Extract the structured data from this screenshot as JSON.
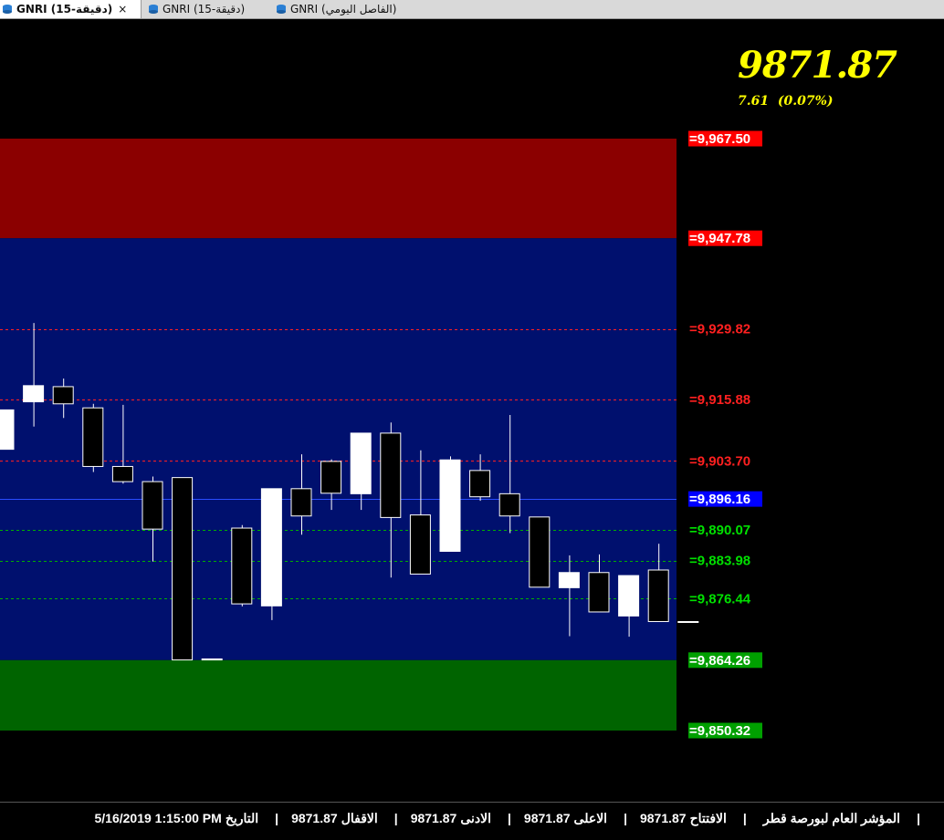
{
  "tabs": [
    {
      "label": "GNRI (15-دقيقة)",
      "active": true,
      "icon": "chart-db-icon"
    },
    {
      "label": "GNRI (15-دقيقة)",
      "active": false,
      "icon": "chart-db-icon"
    },
    {
      "label": "GNRI (الفاصل اليومي)",
      "active": false,
      "icon": "chart-db-icon"
    }
  ],
  "close_glyph": "×",
  "quote": {
    "last": "9871.87",
    "change": "7.61  (0.07%)",
    "color": "#ffff00"
  },
  "zones": [
    {
      "name": "resistance-zone",
      "from": 9947.78,
      "to": 9967.5,
      "color": "#8b0000"
    },
    {
      "name": "neutral-zone",
      "from": 9864.26,
      "to": 9947.78,
      "color": "#00106e"
    },
    {
      "name": "support-zone",
      "from": 9850.32,
      "to": 9864.26,
      "color": "#006400"
    }
  ],
  "levels": [
    {
      "label": "=9,967.50",
      "value": 9967.5,
      "style": "box",
      "bg": "#ff0000",
      "fg": "#ffffff"
    },
    {
      "label": "=9,947.78",
      "value": 9947.78,
      "style": "box",
      "bg": "#ff0000",
      "fg": "#ffffff"
    },
    {
      "label": "=9,929.82",
      "value": 9929.82,
      "style": "dash",
      "fg": "#ff2020",
      "line": "#ff2020"
    },
    {
      "label": "=9,915.88",
      "value": 9915.88,
      "style": "dash",
      "fg": "#ff2020",
      "line": "#ff2020"
    },
    {
      "label": "=9,903.70",
      "value": 9903.7,
      "style": "dash",
      "fg": "#ff2020",
      "line": "#ff2020"
    },
    {
      "label": "=9,896.16",
      "value": 9896.16,
      "style": "boxline",
      "bg": "#0000ff",
      "fg": "#ffffff",
      "line": "#2a4cff"
    },
    {
      "label": "=9,890.07",
      "value": 9890.07,
      "style": "dash",
      "fg": "#00e000",
      "line": "#00b000"
    },
    {
      "label": "=9,883.98",
      "value": 9883.98,
      "style": "dash",
      "fg": "#00e000",
      "line": "#00b000"
    },
    {
      "label": "=9,876.44",
      "value": 9876.44,
      "style": "dash",
      "fg": "#00e000",
      "line": "#00b000"
    },
    {
      "label": "=9,864.26",
      "value": 9864.26,
      "style": "box",
      "bg": "#00a000",
      "fg": "#ffffff"
    },
    {
      "label": "=9,850.32",
      "value": 9850.32,
      "style": "box",
      "bg": "#00a000",
      "fg": "#ffffff"
    }
  ],
  "candles": [
    {
      "o": 9906.0,
      "c": 9913.8,
      "h": 9913.8,
      "l": 9906.0
    },
    {
      "o": 9915.4,
      "c": 9918.6,
      "h": 9931.0,
      "l": 9910.5
    },
    {
      "o": 9918.4,
      "c": 9915.0,
      "h": 9920.0,
      "l": 9912.2
    },
    {
      "o": 9914.2,
      "c": 9902.6,
      "h": 9915.0,
      "l": 9901.5
    },
    {
      "o": 9902.6,
      "c": 9899.6,
      "h": 9914.8,
      "l": 9899.2
    },
    {
      "o": 9899.6,
      "c": 9890.2,
      "h": 9900.6,
      "l": 9883.8
    },
    {
      "o": 9900.4,
      "c": 9864.3,
      "h": 9900.4,
      "l": 9864.3
    },
    {
      "o": 9864.3,
      "c": 9864.5,
      "h": 9864.5,
      "l": 9864.3
    },
    {
      "o": 9890.4,
      "c": 9875.4,
      "h": 9891.0,
      "l": 9874.9
    },
    {
      "o": 9875.0,
      "c": 9898.2,
      "h": 9898.2,
      "l": 9872.2
    },
    {
      "o": 9898.2,
      "c": 9892.8,
      "h": 9905.0,
      "l": 9889.1
    },
    {
      "o": 9903.6,
      "c": 9897.3,
      "h": 9904.0,
      "l": 9894.0
    },
    {
      "o": 9897.2,
      "c": 9909.2,
      "h": 9909.2,
      "l": 9894.0
    },
    {
      "o": 9909.2,
      "c": 9892.5,
      "h": 9911.3,
      "l": 9880.6
    },
    {
      "o": 9893.0,
      "c": 9881.3,
      "h": 9905.8,
      "l": 9881.3
    },
    {
      "o": 9885.8,
      "c": 9903.9,
      "h": 9904.6,
      "l": 9885.8
    },
    {
      "o": 9901.8,
      "c": 9896.6,
      "h": 9905.0,
      "l": 9895.8
    },
    {
      "o": 9897.2,
      "c": 9892.8,
      "h": 9912.8,
      "l": 9889.4
    },
    {
      "o": 9892.6,
      "c": 9878.7,
      "h": 9892.6,
      "l": 9878.7
    },
    {
      "o": 9878.6,
      "c": 9881.6,
      "h": 9885.0,
      "l": 9869.0
    },
    {
      "o": 9881.6,
      "c": 9873.8,
      "h": 9885.2,
      "l": 9873.8
    },
    {
      "o": 9873.0,
      "c": 9881.0,
      "h": 9881.0,
      "l": 9868.9
    },
    {
      "o": 9882.1,
      "c": 9871.9,
      "h": 9887.3,
      "l": 9871.9
    },
    {
      "o": 9871.9,
      "c": 9871.9,
      "h": 9871.9,
      "l": 9871.9
    }
  ],
  "status": {
    "items": [
      {
        "label": "التاريخ",
        "value": "5/16/2019 1:15:00 PM"
      },
      {
        "label": "الاقفال",
        "value": "9871.87"
      },
      {
        "label": "الادنى",
        "value": "9871.87"
      },
      {
        "label": "الاعلى",
        "value": "9871.87"
      },
      {
        "label": "الافتتاح",
        "value": "9871.87"
      }
    ],
    "title": "المؤشر العام لبورصة قطر",
    "separator": "|"
  },
  "colors": {
    "up_candle": "#ffffff",
    "down_candle": "#000000",
    "candle_outline": "#ffffff",
    "background": "#000000"
  }
}
